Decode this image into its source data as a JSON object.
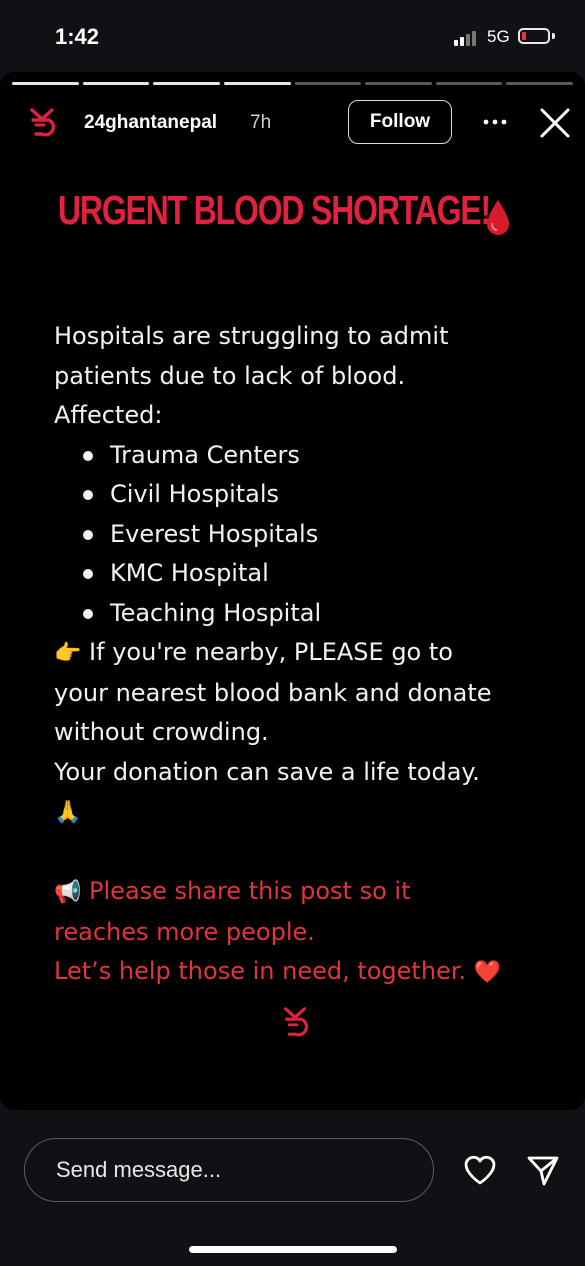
{
  "status_bar": {
    "time": "1:42",
    "network": "5G"
  },
  "story": {
    "progress_total": 8,
    "progress_done": 4,
    "username": "24ghantanepal",
    "time_ago": "7h",
    "follow_label": "Follow",
    "headline": "URGENT BLOOD SHORTAGE!",
    "intro_line1": "Hospitals are struggling to admit",
    "intro_line2": "patients due to lack of blood.",
    "affected_label": "Affected:",
    "affected": [
      "Trauma Centers",
      "Civil Hospitals",
      "Everest Hospitals",
      "KMC Hospital",
      "Teaching Hospital"
    ],
    "cta_emoji": "👉",
    "cta_line1": " If you're nearby, PLEASE go to",
    "cta_line2": "your nearest blood bank and donate",
    "cta_line3": "without crowding.",
    "donation_line": " Your donation can save a life today.",
    "pray_emoji": "🙏",
    "megaphone_emoji": "📢",
    "share_line1": " Please share this post so it",
    "share_line2": "reaches more people.",
    "help_line": " Let’s help those in need, together. ",
    "heart_emoji": "❤️"
  },
  "bottom_bar": {
    "message_placeholder": "Send message..."
  },
  "colors": {
    "accent_red": "#e2203f",
    "background": "#000000"
  },
  "icons": [
    "brand-logo-icon",
    "more-icon",
    "close-icon",
    "blood-drop-icon",
    "heart-icon",
    "send-icon"
  ]
}
